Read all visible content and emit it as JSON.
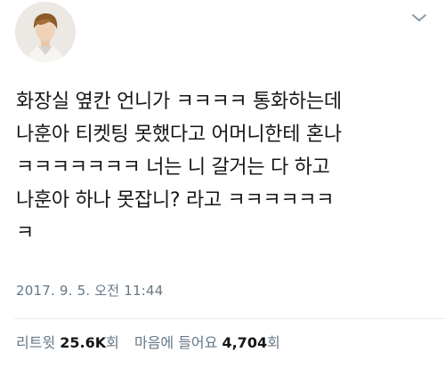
{
  "tweet": {
    "text_lines": [
      "화장실 옆칸 언니가 ㅋㅋㅋㅋ 통화하는데",
      "나훈아 티켓팅 못했다고 어머니한테 혼나",
      "ㅋㅋㅋㅋㅋㅋㅋ 너는 니 갈거는 다 하고",
      "나훈아 하나 못잡니? 라고 ㅋㅋㅋㅋㅋㅋ",
      "ㅋ"
    ],
    "timestamp": "2017. 9. 5. 오전 11:44"
  },
  "stats": {
    "retweet_label": "리트윗",
    "retweet_count": "25.6K",
    "retweet_unit": "회",
    "like_label": "마음에 들어요",
    "like_count": "4,704",
    "like_unit": "회"
  },
  "icons": {
    "menu": "chevron-down-icon",
    "avatar": "avatar"
  },
  "colors": {
    "text": "#14171a",
    "muted": "#657786",
    "divider": "#e6ecf0"
  }
}
